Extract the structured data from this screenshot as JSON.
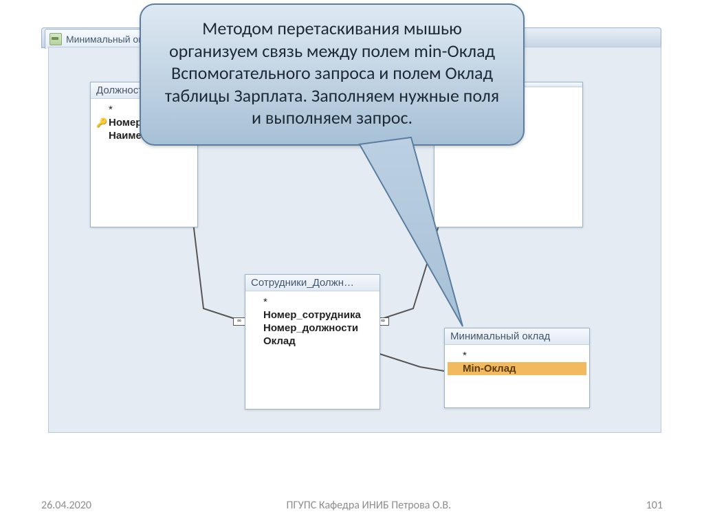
{
  "tab": {
    "title": "Минимальный окл"
  },
  "callout": {
    "text": "Методом перетаскивания мышью организуем связь между полем min-Оклад Вспомогательного запроса и полем Оклад таблицы Зарплата. Заполняем нужные поля и выполняем запрос."
  },
  "tables": {
    "dolzhnosti": {
      "title": "Должности",
      "fields": [
        {
          "name": "*",
          "key": false,
          "star": true
        },
        {
          "name": "Номер",
          "key": true
        },
        {
          "name": "Наимено",
          "key": false
        }
      ]
    },
    "sotrudniki_dolzhn": {
      "title": "Сотрудники_Должн…",
      "fields": [
        {
          "name": "*",
          "key": false,
          "star": true
        },
        {
          "name": "Номер_сотрудника",
          "key": false
        },
        {
          "name": "Номер_должности",
          "key": false
        },
        {
          "name": "Оклад",
          "key": false
        }
      ]
    },
    "min_oklad": {
      "title": "Минимальный оклад",
      "fields": [
        {
          "name": "*",
          "key": false,
          "star": true
        },
        {
          "name": "Min-Оклад",
          "key": false,
          "selected": true
        }
      ]
    }
  },
  "footer": {
    "date": "26.04.2020",
    "org": "ПГУПС   Кафедра   ИНИБ   Петрова О.В.",
    "page": "101"
  }
}
